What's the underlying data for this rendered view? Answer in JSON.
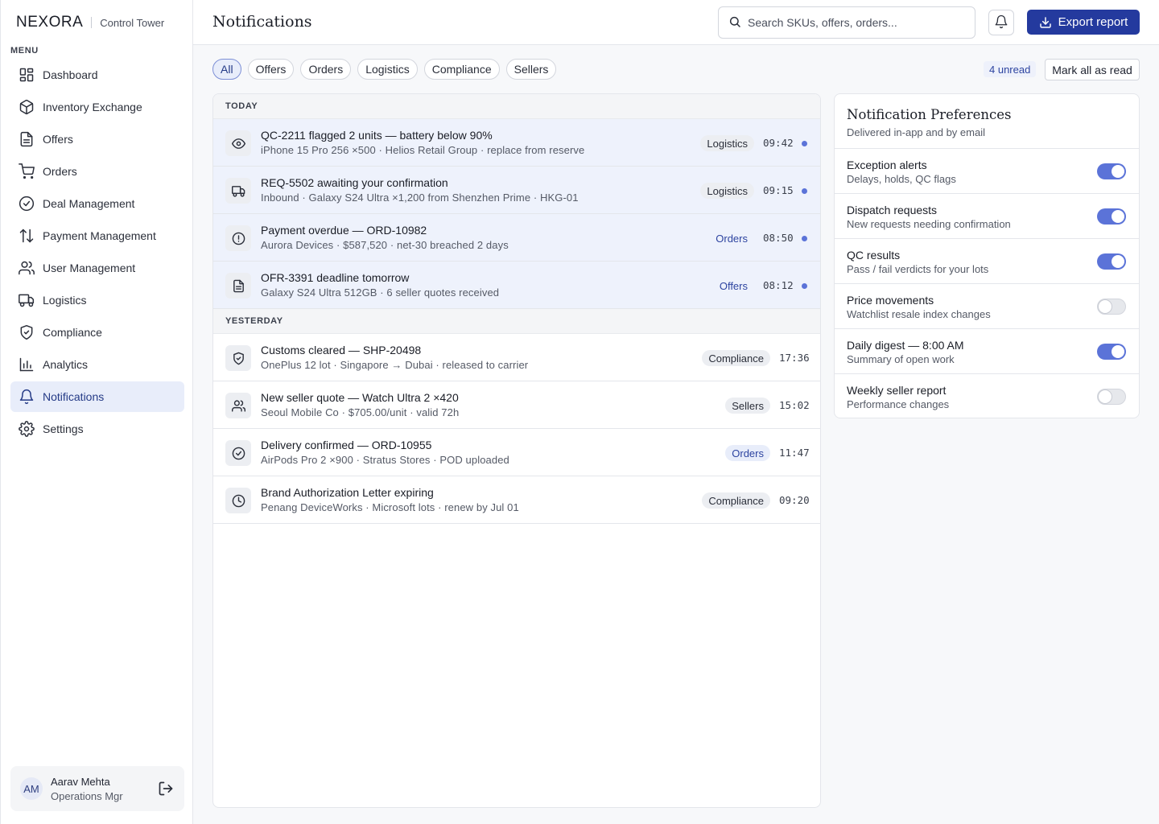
{
  "brand": {
    "logo": "NEXORA",
    "subtitle": "Control Tower"
  },
  "sidebar": {
    "menu_label": "MENU",
    "items": [
      {
        "label": "Dashboard",
        "icon": "dashboard-icon"
      },
      {
        "label": "Inventory Exchange",
        "icon": "box-icon"
      },
      {
        "label": "Offers",
        "icon": "document-icon"
      },
      {
        "label": "Orders",
        "icon": "cart-icon"
      },
      {
        "label": "Deal Management",
        "icon": "check-circle-icon"
      },
      {
        "label": "Payment Management",
        "icon": "arrows-up-down-icon"
      },
      {
        "label": "User Management",
        "icon": "users-icon"
      },
      {
        "label": "Logistics",
        "icon": "truck-icon"
      },
      {
        "label": "Compliance",
        "icon": "shield-check-icon"
      },
      {
        "label": "Analytics",
        "icon": "bar-chart-icon"
      },
      {
        "label": "Notifications",
        "icon": "bell-icon",
        "active": true
      },
      {
        "label": "Settings",
        "icon": "gear-icon"
      }
    ],
    "user": {
      "initials": "AM",
      "name": "Aarav Mehta",
      "role": "Operations Mgr"
    }
  },
  "header": {
    "title": "Notifications",
    "search_placeholder": "Search SKUs, offers, orders...",
    "export_label": "Export report"
  },
  "filters": {
    "chips": [
      "All",
      "Offers",
      "Orders",
      "Logistics",
      "Compliance",
      "Sellers"
    ],
    "active": "All",
    "unread_label": "4 unread",
    "mark_all_label": "Mark all as read"
  },
  "notifications": {
    "today_label": "TODAY",
    "yesterday_label": "YESTERDAY",
    "today": [
      {
        "icon": "eye-icon",
        "title": "QC-2211 flagged 2 units — battery below 90%",
        "subtitle": "iPhone 15 Pro 256 ×500 · Helios Retail Group · replace from reserve",
        "category": "Logistics",
        "time": "09:42",
        "unread": true
      },
      {
        "icon": "truck-icon",
        "title": "REQ-5502 awaiting your confirmation",
        "subtitle": "Inbound · Galaxy S24 Ultra ×1,200 from Shenzhen Prime · HKG-01",
        "category": "Logistics",
        "time": "09:15",
        "unread": true
      },
      {
        "icon": "alert-circle-icon",
        "title": "Payment overdue — ORD-10982",
        "subtitle": "Aurora Devices · $587,520 · net-30 breached 2 days",
        "category": "Orders",
        "time": "08:50",
        "unread": true
      },
      {
        "icon": "document-icon",
        "title": "OFR-3391 deadline tomorrow",
        "subtitle": "Galaxy S24 Ultra 512GB · 6 seller quotes received",
        "category": "Offers",
        "time": "08:12",
        "unread": true
      }
    ],
    "yesterday": [
      {
        "icon": "shield-check-icon",
        "title": "Customs cleared — SHP-20498",
        "subtitle": "OnePlus 12 lot · Singapore → Dubai · released to carrier",
        "category": "Compliance",
        "time": "17:36",
        "unread": false
      },
      {
        "icon": "users-icon",
        "title": "New seller quote — Watch Ultra 2 ×420",
        "subtitle": "Seoul Mobile Co · $705.00/unit · valid 72h",
        "category": "Sellers",
        "time": "15:02",
        "unread": false
      },
      {
        "icon": "check-circle-icon",
        "title": "Delivery confirmed — ORD-10955",
        "subtitle": "AirPods Pro 2 ×900 · Stratus Stores · POD uploaded",
        "category": "Orders",
        "time": "11:47",
        "unread": false
      },
      {
        "icon": "clock-icon",
        "title": "Brand Authorization Letter expiring",
        "subtitle": "Penang DeviceWorks · Microsoft lots · renew by Jul 01",
        "category": "Compliance",
        "time": "09:20",
        "unread": false
      }
    ]
  },
  "preferences": {
    "title": "Notification Preferences",
    "subtitle": "Delivered in-app and by email",
    "items": [
      {
        "label": "Exception alerts",
        "desc": "Delays, holds, QC flags",
        "enabled": true
      },
      {
        "label": "Dispatch requests",
        "desc": "New requests needing confirmation",
        "enabled": true
      },
      {
        "label": "QC results",
        "desc": "Pass / fail verdicts for your lots",
        "enabled": true
      },
      {
        "label": "Price movements",
        "desc": "Watchlist resale index changes",
        "enabled": false
      },
      {
        "label": "Daily digest — 8:00 AM",
        "desc": "Summary of open work",
        "enabled": true
      },
      {
        "label": "Weekly seller report",
        "desc": "Performance changes",
        "enabled": false
      }
    ]
  },
  "colors": {
    "accent": "#243a9e",
    "unread_dot": "#5b73d8",
    "active_nav_bg": "#e8edfa",
    "toggle_on": "#5b73d8"
  }
}
